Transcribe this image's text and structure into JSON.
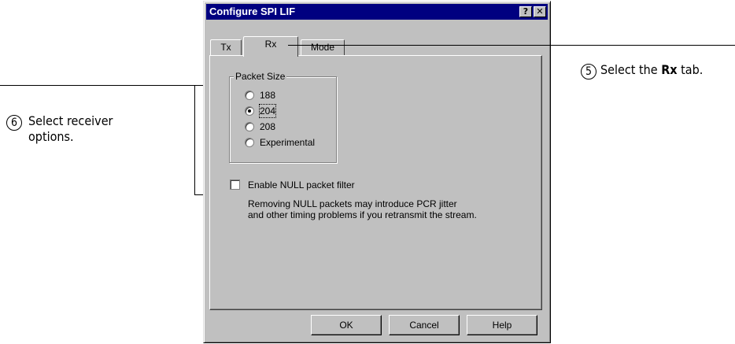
{
  "dialog": {
    "title": "Configure SPI LIF",
    "help_glyph": "?",
    "close_glyph": "✕",
    "tabs": [
      {
        "label": "Tx"
      },
      {
        "label": "Rx"
      },
      {
        "label": "Mode"
      }
    ],
    "active_tab": "Rx",
    "packet_size": {
      "label": "Packet Size",
      "options": [
        {
          "label": "188",
          "selected": false
        },
        {
          "label": "204",
          "selected": true
        },
        {
          "label": "208",
          "selected": false
        },
        {
          "label": "Experimental",
          "selected": false
        }
      ]
    },
    "null_filter": {
      "label": "Enable NULL packet filter",
      "checked": false,
      "note_line1": "Removing NULL packets may introduce PCR jitter",
      "note_line2": "and other timing problems if you retransmit the stream."
    },
    "buttons": {
      "ok": "OK",
      "cancel": "Cancel",
      "help": "Help"
    }
  },
  "callouts": {
    "step5": {
      "number": "5",
      "text_before": "Select the ",
      "text_bold": "Rx",
      "text_after": " tab."
    },
    "step6": {
      "number": "6",
      "line1": "Select receiver",
      "line2": "options."
    }
  }
}
